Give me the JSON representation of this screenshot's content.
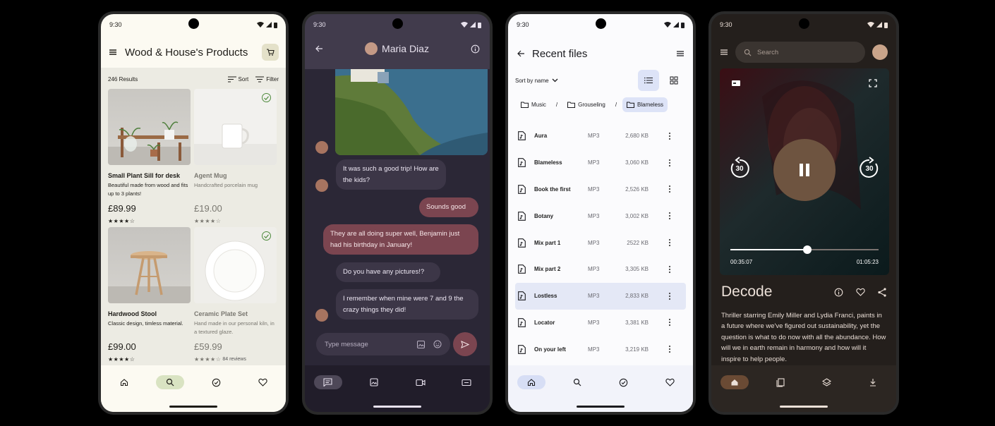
{
  "status_time": "9:30",
  "shop": {
    "title": "Wood & House's Products",
    "results": "246 Results",
    "sort_label": "Sort",
    "filter_label": "Filter",
    "products": [
      {
        "name": "Small Plant Sill for desk",
        "desc": "Beautiful made from wood and fits up to 3 plants!",
        "price": "£89.99",
        "rating": 4.5,
        "reviews": "",
        "selected": false
      },
      {
        "name": "Agent Mug",
        "desc": "Handcrafted porcelain mug",
        "price": "£19.00",
        "rating": 4.5,
        "reviews": "",
        "selected": true
      },
      {
        "name": "Hardwood Stool",
        "desc": "Classic design, timless material.",
        "price": "£99.00",
        "rating": 4.5,
        "reviews": "",
        "selected": false
      },
      {
        "name": "Ceramic Plate Set",
        "desc": "Hand made in our personal kiln, in a textured glaze.",
        "price": "£59.99",
        "rating": 4.5,
        "reviews": "84 reviews",
        "selected": true
      }
    ],
    "nav_active": "search"
  },
  "chat": {
    "contact": "Maria Diaz",
    "messages": [
      {
        "from": "in",
        "text": "It was such a good trip! How are the kids?"
      },
      {
        "from": "out",
        "text": "Sounds good"
      },
      {
        "from": "out",
        "text": "They are all doing super well, Benjamin just had his birthday in January!"
      },
      {
        "from": "in",
        "text": "Do you have any pictures!?"
      },
      {
        "from": "in",
        "text": "I remember when mine were 7 and 9 the crazy things they did!"
      }
    ],
    "input_placeholder": "Type message",
    "nav_active": "messages"
  },
  "files": {
    "title": "Recent files",
    "sort_label": "Sort by name",
    "view_active": "list",
    "breadcrumbs": [
      "Music",
      "Grouseling",
      "Blameless"
    ],
    "list": [
      {
        "name": "Aura",
        "type": "MP3",
        "size": "2,680 KB",
        "selected": false
      },
      {
        "name": "Blameless",
        "type": "MP3",
        "size": "3,060 KB",
        "selected": false
      },
      {
        "name": "Book the first",
        "type": "MP3",
        "size": "2,526 KB",
        "selected": false
      },
      {
        "name": "Botany",
        "type": "MP3",
        "size": "3,002 KB",
        "selected": false
      },
      {
        "name": "Mix part 1",
        "type": "MP3",
        "size": "2522 KB",
        "selected": false
      },
      {
        "name": "Mix part 2",
        "type": "MP3",
        "size": "3,305 KB",
        "selected": false
      },
      {
        "name": "Lostless",
        "type": "MP3",
        "size": "2,833 KB",
        "selected": true
      },
      {
        "name": "Locator",
        "type": "MP3",
        "size": "3,381 KB",
        "selected": false
      },
      {
        "name": "On your left",
        "type": "MP3",
        "size": "3,219 KB",
        "selected": false
      }
    ],
    "nav_active": "home"
  },
  "video": {
    "search_placeholder": "Search",
    "title": "Decode",
    "elapsed": "00:35:07",
    "duration": "01:05:23",
    "progress": 0.52,
    "skip_seconds": "30",
    "description": "Thriller starring Emily Miller and Lydia Franci, paints in a future where we've figured out sustainability, yet the question is what to do now with all the abundance. How will we in earth remain in harmony and how will it inspire to help people.",
    "nav_active": "home"
  },
  "colors": {
    "shop_bg": "#fcfaf2",
    "chat_bg": "#2b2736",
    "chat_out_bubble": "#7b4550",
    "files_accent": "#dde3f7",
    "video_accent": "#6e5440"
  }
}
